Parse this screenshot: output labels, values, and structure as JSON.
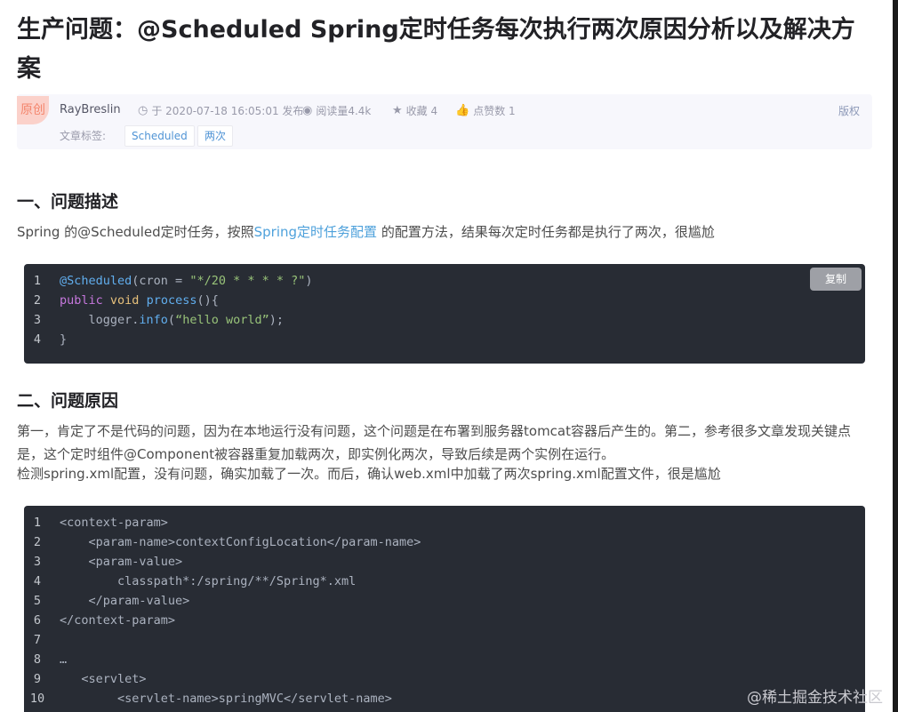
{
  "article": {
    "title": "生产问题：@Scheduled Spring定时任务每次执行两次原因分析以及解决方案",
    "badge": "原创",
    "author": "RayBreslin",
    "publish": "于 2020-07-18 16:05:01 发布",
    "reads": "阅读量4.4k",
    "favorites": "收藏 4",
    "likes": "点赞数 1",
    "copyright": "版权",
    "tags_label": "文章标签:",
    "tags": [
      "Scheduled",
      "两次"
    ]
  },
  "section1": {
    "heading": "一、问题描述",
    "para_before": "Spring 的@Scheduled定时任务，按照",
    "para_link": "Spring定时任务配置",
    "para_after": " 的配置方法，结果每次定时任务都是执行了两次，很尴尬"
  },
  "code1": {
    "copy_label": "复制",
    "line_numbers": [
      "1",
      "2",
      "3",
      "4"
    ]
  },
  "section2": {
    "heading": "二、问题原因",
    "para1": "第一，肯定了不是代码的问题，因为在本地运行没有问题，这个问题是在布署到服务器tomcat容器后产生的。第二，参考很多文章发现关键点是，这个定时组件@Component被容器重复加载两次，即实例化两次，导致后续是两个实例在运行。",
    "para2": "检测spring.xml配置，没有问题，确实加载了一次。而后，确认web.xml中加载了两次spring.xml配置文件，很是尴尬"
  },
  "code2": {
    "line_numbers": [
      "1",
      "2",
      "3",
      "4",
      "5",
      "6",
      "7",
      "8",
      "9",
      "10"
    ],
    "lines": [
      "<context-param>",
      "    <param-name>contextConfigLocation</param-name>",
      "    <param-value>",
      "        classpath*:/spring/**/Spring*.xml",
      "    </param-value>",
      "</context-param>",
      "",
      "…",
      "   <servlet>",
      "        <servlet-name>springMVC</servlet-name>"
    ]
  },
  "watermark": "@稀土掘金技术社区"
}
